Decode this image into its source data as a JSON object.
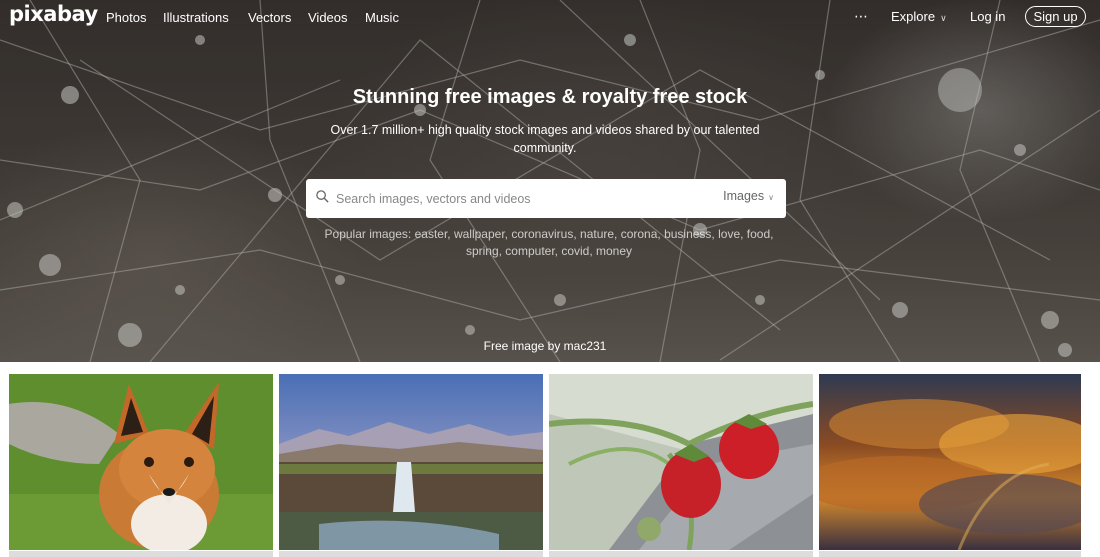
{
  "nav": {
    "logo": "pixabay",
    "links": [
      "Photos",
      "Illustrations",
      "Vectors",
      "Videos",
      "Music"
    ],
    "more_icon": "⋯",
    "explore_label": "Explore",
    "login_label": "Log in",
    "signup_label": "Sign up"
  },
  "hero": {
    "title": "Stunning free images & royalty free stock",
    "subtitle": "Over 1.7 million+ high quality stock images and videos shared by our talented community.",
    "search": {
      "placeholder": "Search images, vectors and videos",
      "value": "",
      "type_label": "Images",
      "icon": "search-icon"
    },
    "popular_label": "Popular images:",
    "popular_tags": "easter, wallpaper, coronavirus, nature, corona, business, love, food, spring, computer, covid, money",
    "credit": "Free image by mac231"
  },
  "gallery": {
    "items": [
      "fox",
      "waterfall-landscape",
      "strawberries",
      "sunset-clouds"
    ]
  }
}
